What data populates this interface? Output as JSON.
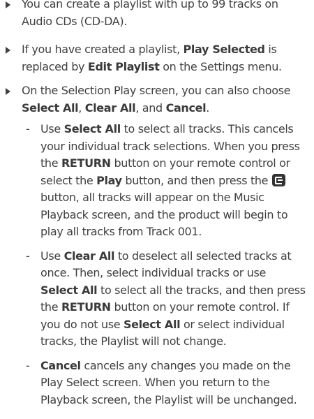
{
  "bullets": [
    {
      "text": "You can create a playlist with up to 99 tracks on Audio CDs (CD-DA)."
    },
    {
      "t1": "If you have created a playlist, ",
      "b1": "Play Selected",
      "t2": " is replaced by ",
      "b2": "Edit Playlist",
      "t3": " on the Settings menu."
    },
    {
      "t1": "On the Selection Play screen, you can also choose ",
      "b1": "Select All",
      "t2": ", ",
      "b2": "Clear All",
      "t3": ", and ",
      "b3": "Cancel",
      "t4": "."
    }
  ],
  "sub_items": [
    {
      "dash": "-",
      "t1": "Use ",
      "b1": "Select All",
      "t2": " to select all tracks. This cancels your individual track selections. When you press the ",
      "b2": "RETURN",
      "t3": " button on your remote control or select the ",
      "b3": "Play",
      "t4": " button, and then press the ",
      "icon": "enter-key-icon",
      "t5": " button, all tracks will appear on the Music Playback screen, and the product will begin to play all tracks from Track 001."
    },
    {
      "dash": "-",
      "t1": "Use ",
      "b1": "Clear All",
      "t2": " to deselect all selected tracks at once. Then, select individual tracks or use ",
      "b2": "Select All",
      "t3": " to select all the tracks, and then press the ",
      "b3": "RETURN",
      "t4": " button on your remote control. If you do not use ",
      "b4": "Select All",
      "t5": " or select individual tracks, the Playlist will not change."
    },
    {
      "dash": "-",
      "b1": "Cancel",
      "t1": " cancels any changes you made on the Play Select screen. When you return to the Playback screen, the Playlist will be unchanged."
    }
  ]
}
